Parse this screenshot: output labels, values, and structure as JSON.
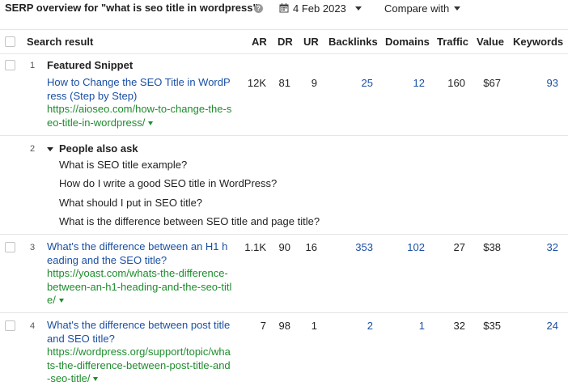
{
  "header": {
    "title": "SERP overview for \"what is seo title in wordpress\"",
    "help_icon": "question-circle-icon",
    "date": "4 Feb 2023",
    "compare_label": "Compare with"
  },
  "columns": [
    "Search result",
    "AR",
    "DR",
    "UR",
    "Backlinks",
    "Domains",
    "Traffic",
    "Value",
    "Keywords"
  ],
  "rows": {
    "r1": {
      "num": "1",
      "section": "Featured Snippet",
      "title": "How to Change the SEO Title in WordPress (Step by Step)",
      "url": "https://aioseo.com/how-to-change-the-seo-title-in-wordpress/",
      "ar": "12K",
      "dr": "81",
      "ur": "9",
      "backlinks": "25",
      "domains": "12",
      "traffic": "160",
      "value": "$67",
      "keywords": "93"
    },
    "r2": {
      "num": "2",
      "section": "People also ask",
      "questions": [
        "What is SEO title example?",
        "How do I write a good SEO title in WordPress?",
        "What should I put in SEO title?",
        "What is the difference between SEO title and page title?"
      ]
    },
    "r3": {
      "num": "3",
      "title": "What's the difference between an H1 heading and the SEO title?",
      "url": "https://yoast.com/whats-the-difference-between-an-h1-heading-and-the-seo-title/",
      "ar": "1.1K",
      "dr": "90",
      "ur": "16",
      "backlinks": "353",
      "domains": "102",
      "traffic": "27",
      "value": "$38",
      "keywords": "32"
    },
    "r4": {
      "num": "4",
      "title": "What's the difference between post title and SEO title?",
      "url": "https://wordpress.org/support/topic/whats-the-difference-between-post-title-and-seo-title/",
      "ar": "7",
      "dr": "98",
      "ur": "1",
      "backlinks": "2",
      "domains": "1",
      "traffic": "32",
      "value": "$35",
      "keywords": "24"
    }
  },
  "colors": {
    "link": "#1a4fa3",
    "url": "#1e8c2e",
    "border": "#e6e6e6"
  }
}
